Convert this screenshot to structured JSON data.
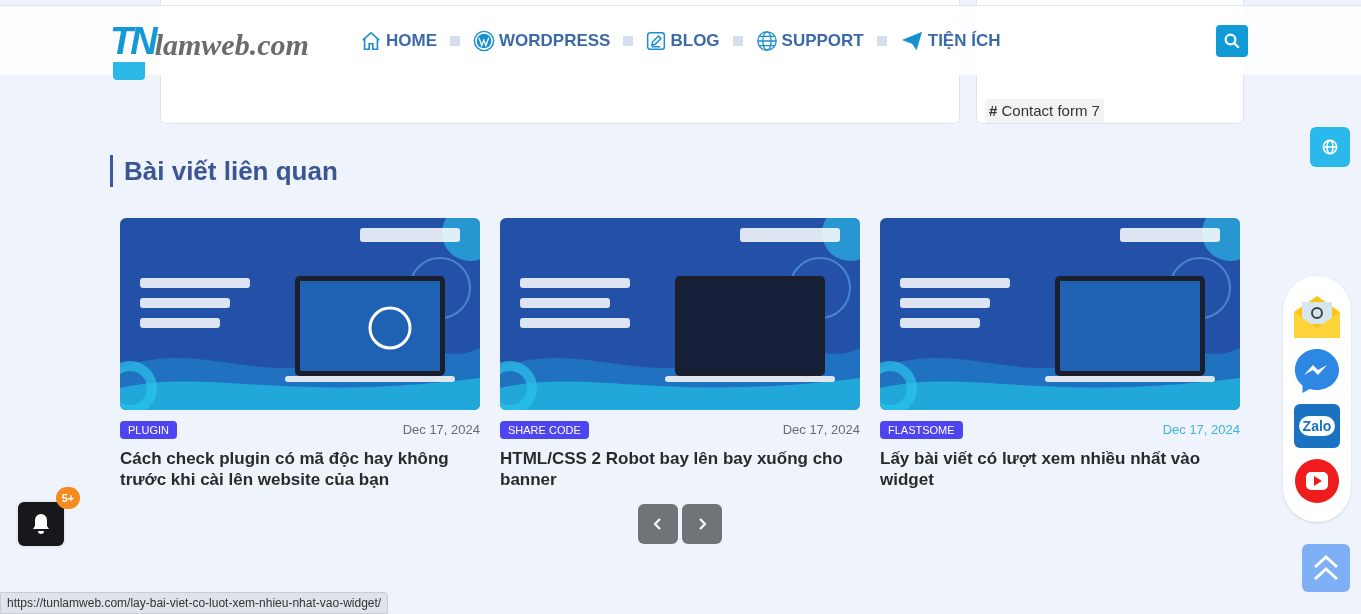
{
  "header": {
    "logo_mark": "TN",
    "logo_text": "lamweb.com",
    "nav": [
      {
        "label": "HOME",
        "kind": "home"
      },
      {
        "label": "WORDPRESS",
        "kind": "wordpress"
      },
      {
        "label": "BLOG",
        "kind": "blog"
      },
      {
        "label": "SUPPORT",
        "kind": "globe"
      },
      {
        "label": "TIỆN ÍCH",
        "kind": "plane"
      }
    ]
  },
  "tags": [
    {
      "label": "Contact form 7"
    }
  ],
  "tag_symbol": "#",
  "related": {
    "title": "Bài viết liên quan",
    "posts": [
      {
        "category": "PLUGIN",
        "date": "Dec 17, 2024",
        "title": "Cách check plugin có mã độc hay không trước khi cài lên website của bạn",
        "hovered": false
      },
      {
        "category": "SHARE CODE",
        "date": "Dec 17, 2024",
        "title": "HTML/CSS 2 Robot bay lên bay xuống cho banner",
        "hovered": false
      },
      {
        "category": "FLASTSOME",
        "date": "Dec 17, 2024",
        "title": "Lấy bài viết có lượt xem nhiều nhất vào widget",
        "hovered": true
      }
    ]
  },
  "notification_badge": "5+",
  "contact_buttons": [
    {
      "kind": "email"
    },
    {
      "kind": "messenger"
    },
    {
      "kind": "zalo",
      "label": "Zalo"
    },
    {
      "kind": "youtube"
    }
  ],
  "status_url": "https://tunlamweb.com/lay-bai-viet-co-luot-xem-nhieu-nhat-vao-widget/"
}
